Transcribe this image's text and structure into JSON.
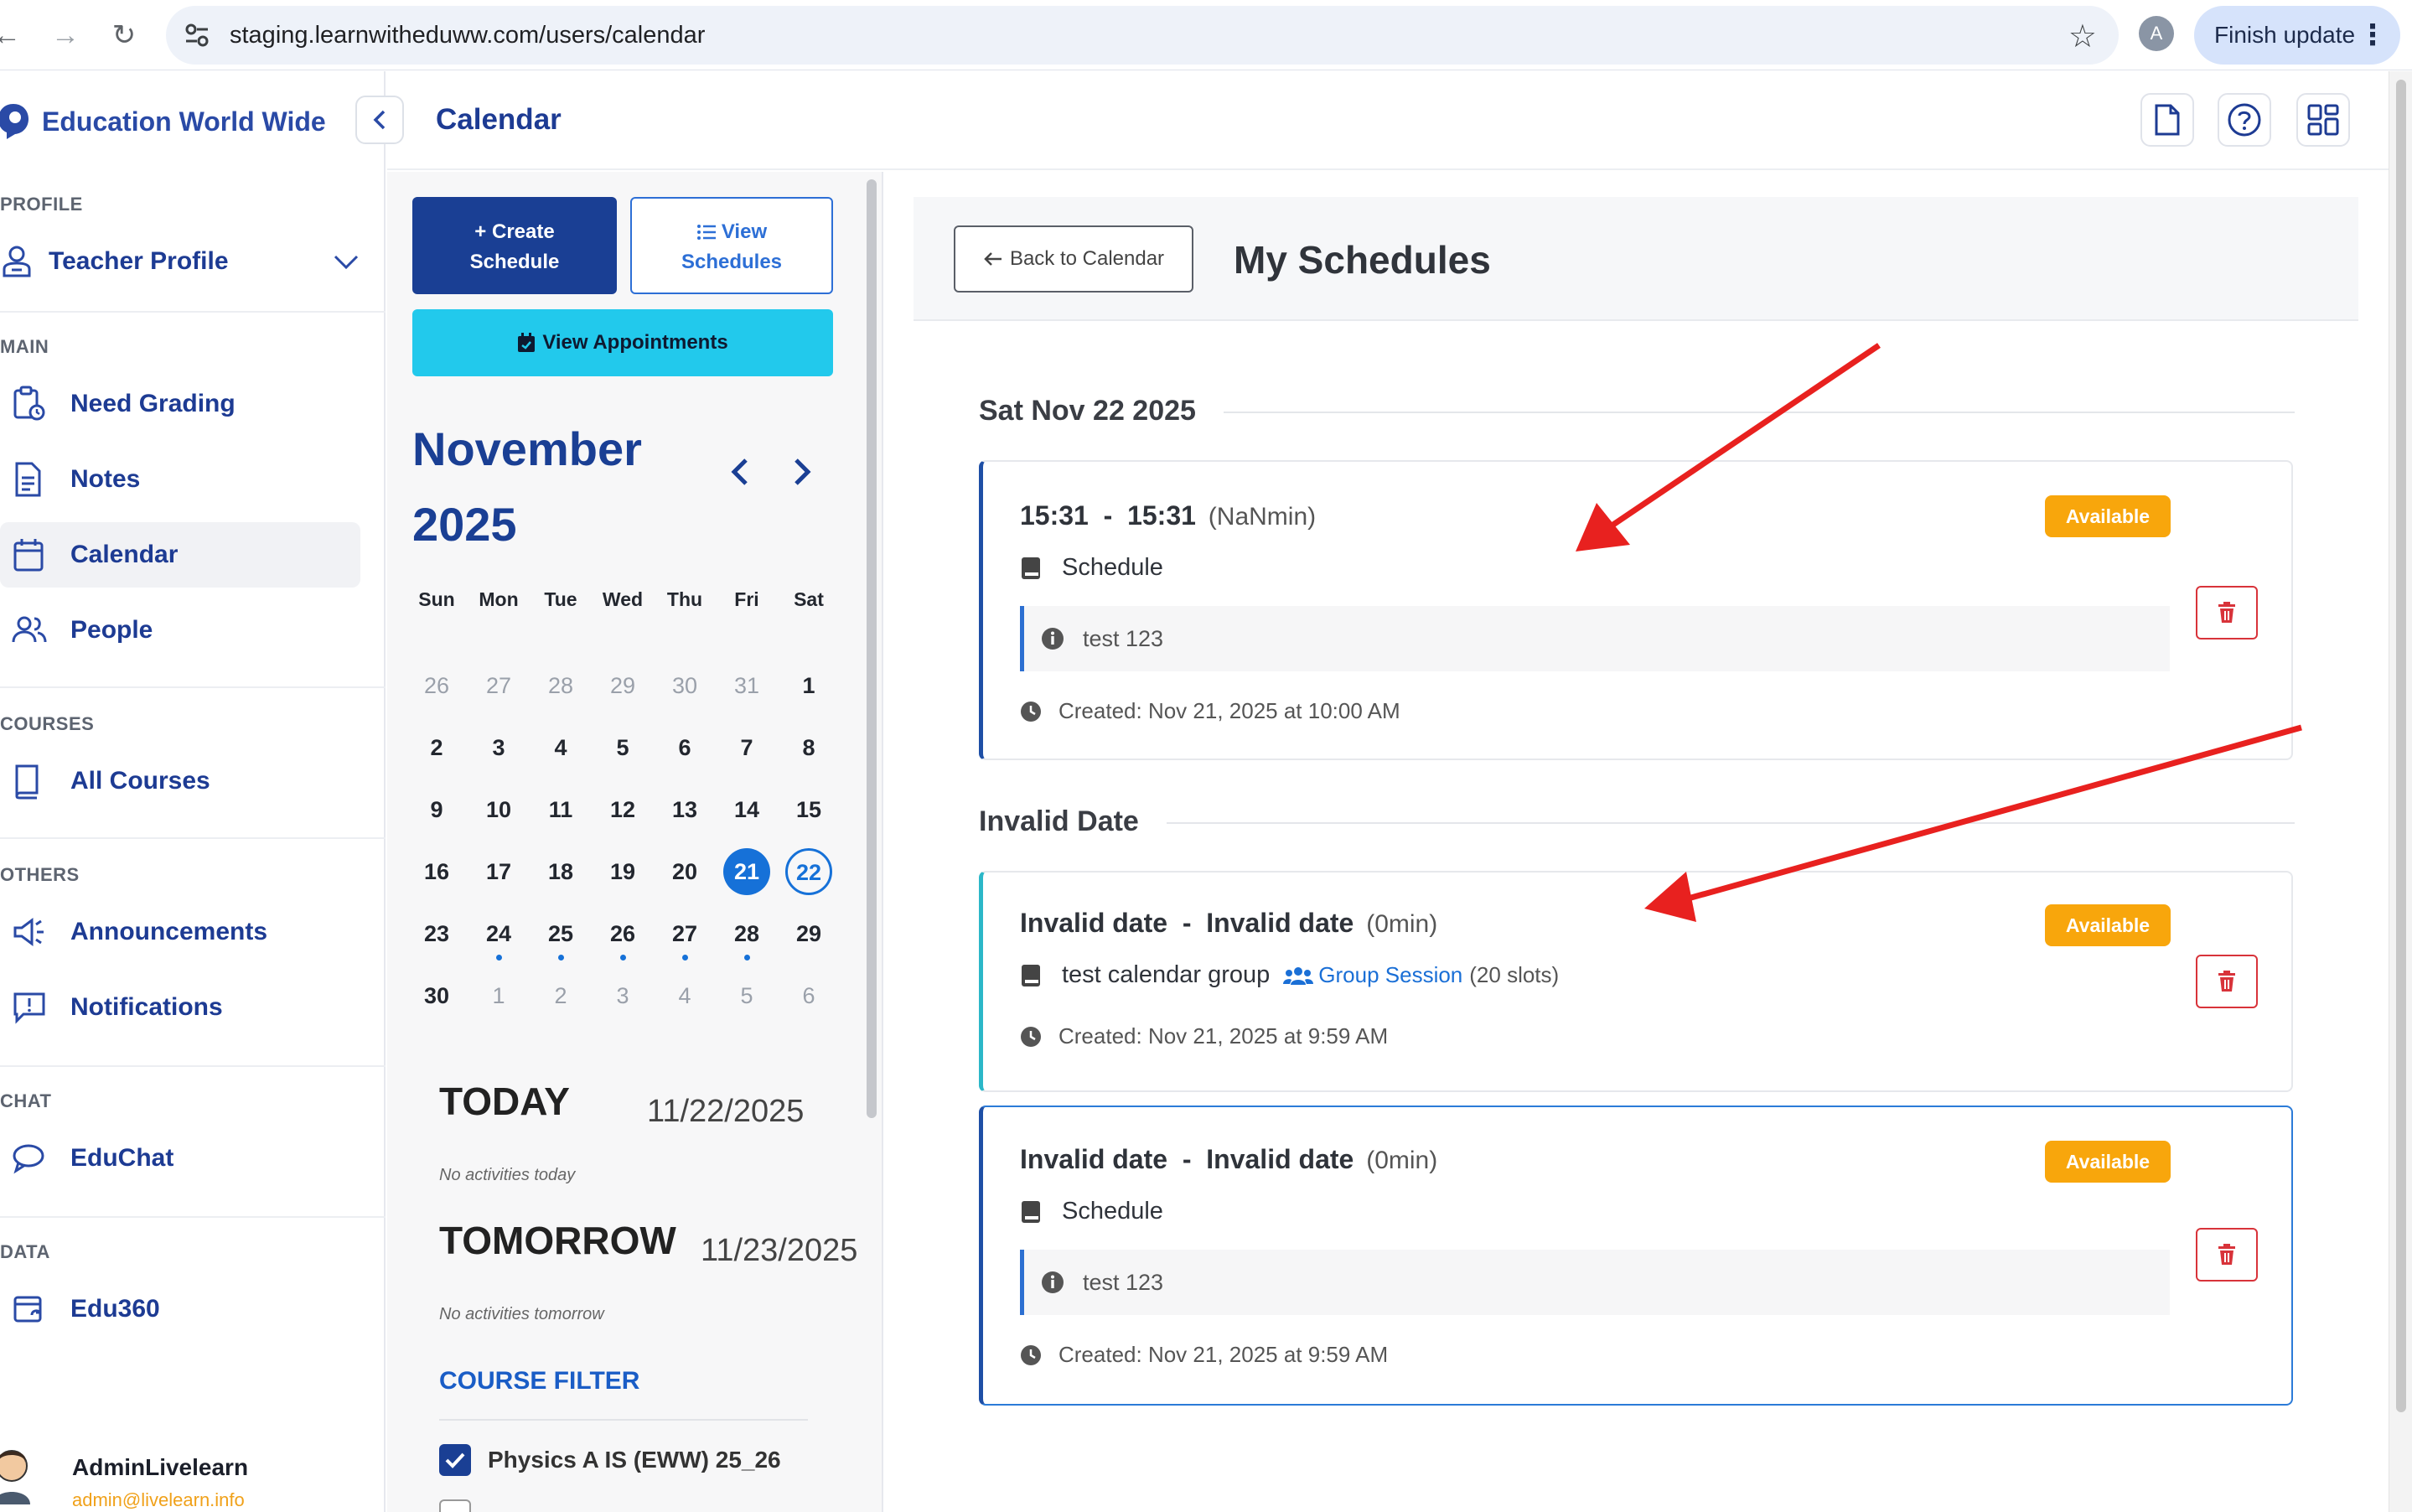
{
  "browser": {
    "url": "staging.learnwitheduww.com/users/calendar",
    "profile_initial": "A",
    "finish_update_label": "Finish update"
  },
  "sidebar": {
    "brand": "Education World Wide",
    "sections": {
      "profile": "PROFILE",
      "main": "MAIN",
      "courses": "COURSES",
      "others": "OTHERS",
      "chat": "CHAT",
      "data": "DATA"
    },
    "teacher_profile": "Teacher Profile",
    "items": [
      {
        "label": "Need Grading",
        "icon": "clipboard-clock-icon"
      },
      {
        "label": "Notes",
        "icon": "document-icon"
      },
      {
        "label": "Calendar",
        "icon": "calendar-icon",
        "active": true
      },
      {
        "label": "People",
        "icon": "people-icon"
      },
      {
        "label": "All Courses",
        "icon": "book-icon"
      },
      {
        "label": "Announcements",
        "icon": "megaphone-icon"
      },
      {
        "label": "Notifications",
        "icon": "alert-message-icon"
      },
      {
        "label": "EduChat",
        "icon": "chat-bubble-icon"
      },
      {
        "label": "Edu360",
        "icon": "refresh-calendar-icon"
      }
    ],
    "user": {
      "name": "AdminLivelearn",
      "email": "admin@livelearn.info"
    }
  },
  "topbar": {
    "title": "Calendar"
  },
  "calendar": {
    "create_label_1": "+ Create",
    "create_label_2": "Schedule",
    "view_label_1": "View",
    "view_label_2": "Schedules",
    "appointments_label": "View Appointments",
    "month": "November",
    "year": "2025",
    "weekdays": [
      "Sun",
      "Mon",
      "Tue",
      "Wed",
      "Thu",
      "Fri",
      "Sat"
    ],
    "weeks": [
      [
        "26",
        "27",
        "28",
        "29",
        "30",
        "31",
        "1"
      ],
      [
        "2",
        "3",
        "4",
        "5",
        "6",
        "7",
        "8"
      ],
      [
        "9",
        "10",
        "11",
        "12",
        "13",
        "14",
        "15"
      ],
      [
        "16",
        "17",
        "18",
        "19",
        "20",
        "21",
        "22"
      ],
      [
        "23",
        "24",
        "25",
        "26",
        "27",
        "28",
        "29"
      ],
      [
        "30",
        "1",
        "2",
        "3",
        "4",
        "5",
        "6"
      ]
    ],
    "today_label": "TODAY",
    "today_date": "11/22/2025",
    "today_empty": "No activities today",
    "tomorrow_label": "TOMORROW",
    "tomorrow_date": "11/23/2025",
    "tomorrow_empty": "No activities tomorrow",
    "course_filter_title": "COURSE FILTER",
    "course_filter_items": [
      {
        "label": "Physics A IS (EWW) 25_26",
        "checked": true
      }
    ]
  },
  "schedules": {
    "back_label": "Back to Calendar",
    "title": "My Schedules",
    "groups": [
      {
        "heading": "Sat Nov 22 2025",
        "cards": [
          {
            "start": "15:31",
            "end": "15:31",
            "duration": "(NaNmin)",
            "status": "Available",
            "name": "Schedule",
            "note": "test 123",
            "created": "Created: Nov 21, 2025 at 10:00 AM"
          }
        ]
      },
      {
        "heading": "Invalid Date",
        "cards": [
          {
            "start": "Invalid date",
            "end": "Invalid date",
            "duration": "(0min)",
            "status": "Available",
            "name": "test calendar group",
            "group_label": "Group Session",
            "slots": "(20 slots)",
            "created": "Created: Nov 21, 2025 at 9:59 AM"
          },
          {
            "start": "Invalid date",
            "end": "Invalid date",
            "duration": "(0min)",
            "status": "Available",
            "name": "Schedule",
            "note": "test 123",
            "created": "Created: Nov 21, 2025 at 9:59 AM"
          }
        ]
      }
    ]
  },
  "colors": {
    "brand_blue": "#1a3f94",
    "accent_blue": "#1671d8",
    "cyan_button": "#22c9ec",
    "status_available": "#f8a60c",
    "delete_red": "#d8333a",
    "annotation_arrow": "#e8211f"
  }
}
